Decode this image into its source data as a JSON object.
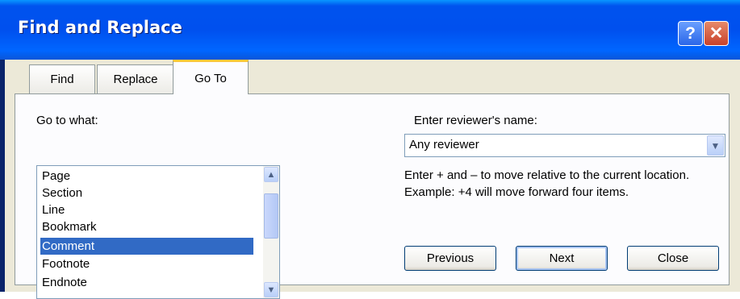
{
  "window": {
    "title": "Find and Replace",
    "help_glyph": "?",
    "close_glyph": "✕"
  },
  "tabs": [
    {
      "label": "Find",
      "active": false
    },
    {
      "label": "Replace",
      "active": false
    },
    {
      "label": "Go To",
      "active": true
    }
  ],
  "goto": {
    "label": "Go to what:",
    "items": [
      "Page",
      "Section",
      "Line",
      "Bookmark",
      "Comment",
      "Footnote",
      "Endnote"
    ],
    "selected": "Comment"
  },
  "reviewer": {
    "label": "Enter reviewer's name:",
    "value": "Any reviewer"
  },
  "help_text": "Enter + and – to move relative to the current location. Example: +4 will move forward four items.",
  "buttons": {
    "previous": "Previous",
    "next": "Next",
    "close": "Close"
  },
  "colors": {
    "title_bar": "#0053ee",
    "selection": "#316ac5",
    "active_tab_highlight": "#ffc83c",
    "dialog_background": "#ece9d8"
  },
  "icons": {
    "help": "question-mark-icon",
    "close": "close-x-icon",
    "scroll_up": "chevron-up-icon",
    "scroll_down": "chevron-down-icon",
    "dropdown": "chevron-down-icon"
  }
}
